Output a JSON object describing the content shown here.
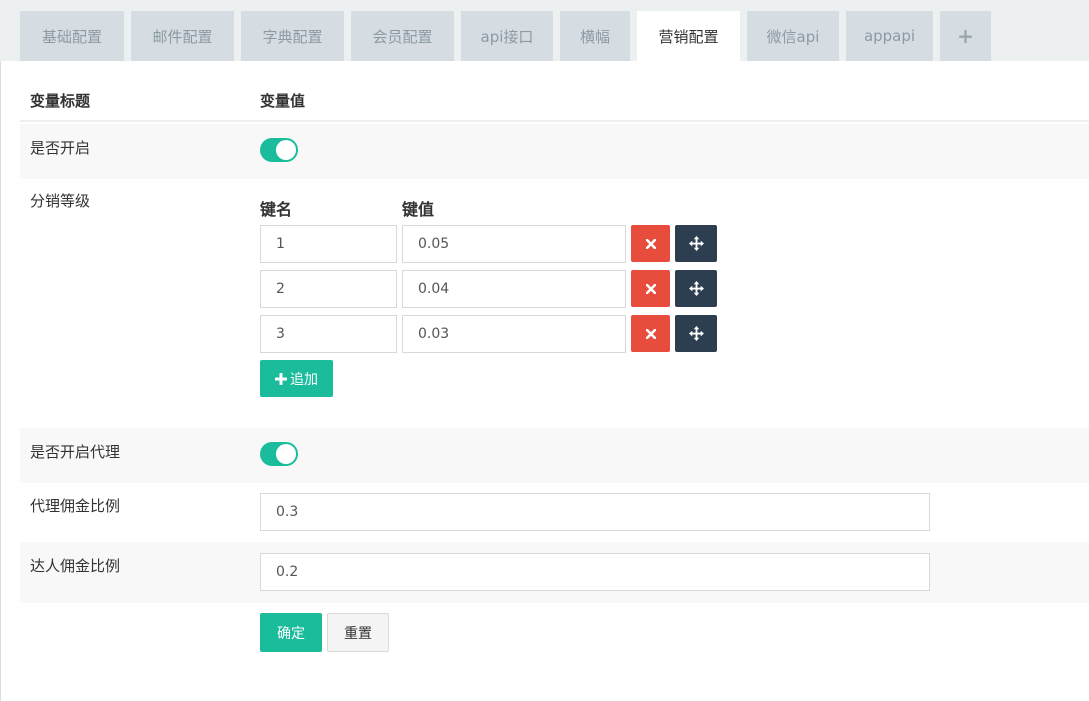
{
  "tabs": [
    {
      "label": "基础配置",
      "active": false
    },
    {
      "label": "邮件配置",
      "active": false
    },
    {
      "label": "字典配置",
      "active": false
    },
    {
      "label": "会员配置",
      "active": false
    },
    {
      "label": "api接口",
      "active": false
    },
    {
      "label": "横幅",
      "active": false
    },
    {
      "label": "营销配置",
      "active": true
    },
    {
      "label": "微信api",
      "active": false
    },
    {
      "label": "appapi",
      "active": false
    },
    {
      "label": "+",
      "active": false
    }
  ],
  "table": {
    "header_title": "变量标题",
    "header_value": "变量值"
  },
  "settings": {
    "enable_label": "是否开启",
    "enable_on": true,
    "levels_label": "分销等级",
    "levels_key_header": "键名",
    "levels_value_header": "键值",
    "levels": [
      {
        "key": "1",
        "value": "0.05"
      },
      {
        "key": "2",
        "value": "0.04"
      },
      {
        "key": "3",
        "value": "0.03"
      }
    ],
    "add_label": "追加",
    "agent_label": "是否开启代理",
    "agent_on": true,
    "agent_rate_label": "代理佣金比例",
    "agent_rate_value": "0.3",
    "talent_rate_label": "达人佣金比例",
    "talent_rate_value": "0.2"
  },
  "actions": {
    "confirm_label": "确定",
    "reset_label": "重置"
  },
  "colors": {
    "accent": "#1abc9c",
    "danger": "#e74c3c",
    "dark": "#2c3e50"
  },
  "icons": {
    "delete": "close-icon",
    "move": "move-arrows-icon",
    "add": "plus-icon"
  }
}
